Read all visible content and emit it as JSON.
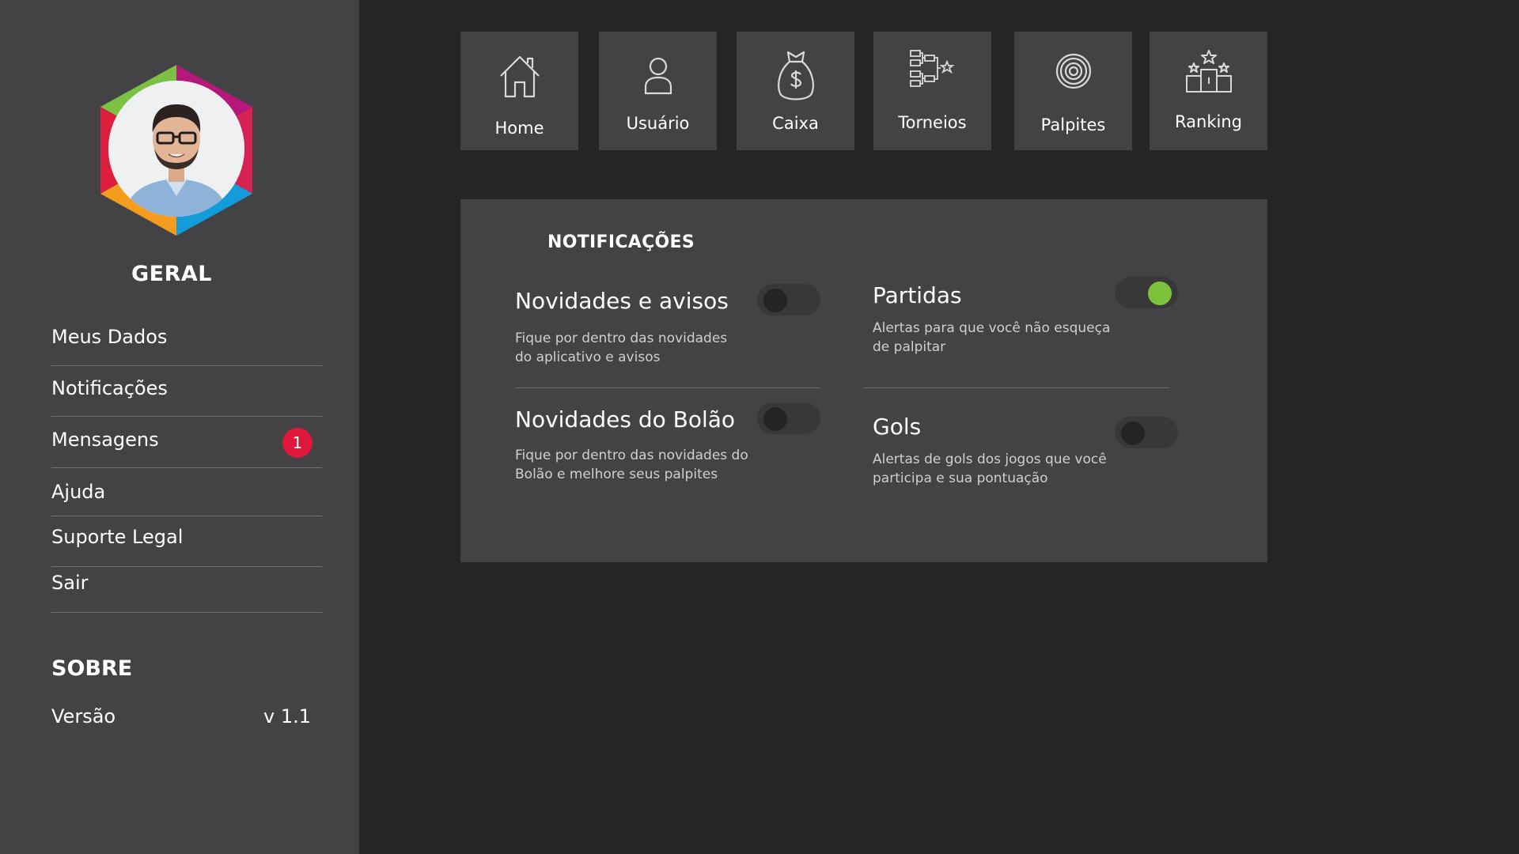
{
  "sidebar": {
    "section_general": "GERAL",
    "menu": [
      {
        "label": "Meus Dados"
      },
      {
        "label": "Notificações"
      },
      {
        "label": "Mensagens",
        "badge": "1"
      },
      {
        "label": "Ajuda"
      },
      {
        "label": "Suporte Legal"
      },
      {
        "label": "Sair"
      }
    ],
    "section_about": "SOBRE",
    "version_label": "Versão",
    "version_value": "v 1.1",
    "badge_color": "#e0163b"
  },
  "nav": {
    "tiles": [
      {
        "label": "Home",
        "icon": "home-icon"
      },
      {
        "label": "Usuário",
        "icon": "user-icon"
      },
      {
        "label": "Caixa",
        "icon": "money-bag-icon"
      },
      {
        "label": "Torneios",
        "icon": "bracket-icon"
      },
      {
        "label": "Palpites",
        "icon": "target-icon"
      },
      {
        "label": "Ranking",
        "icon": "podium-icon"
      }
    ]
  },
  "notifications": {
    "title": "NOTIFICAÇÕES",
    "options": [
      {
        "title": "Novidades e avisos",
        "desc_line1": "Fique por dentro das novidades",
        "desc_line2": "do aplicativo e avisos",
        "enabled": false
      },
      {
        "title": "Partidas",
        "desc_line1": "Alertas para que você não esqueça",
        "desc_line2": "de palpitar",
        "enabled": true
      },
      {
        "title": "Novidades do Bolão",
        "desc_line1": "Fique por dentro das novidades do",
        "desc_line2": "Bolão e melhore seus palpites",
        "enabled": false
      },
      {
        "title": "Gols",
        "desc_line1": "Alertas de gols dos jogos que você",
        "desc_line2": "participa e sua pontuação",
        "enabled": false
      }
    ],
    "toggle_on_color": "#7dc23a"
  }
}
